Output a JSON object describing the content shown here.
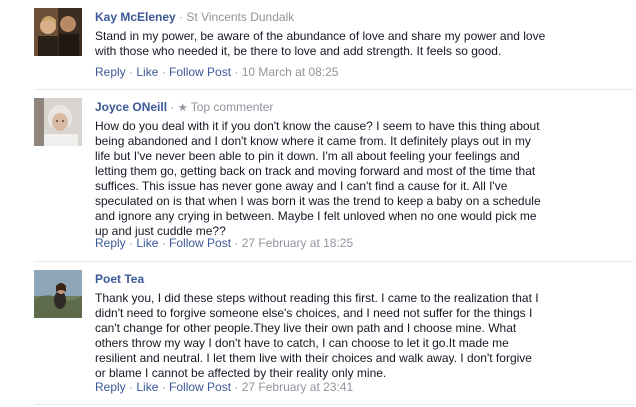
{
  "comments": [
    {
      "name": "Kay McEleney",
      "separator": " · ",
      "affiliation": "St Vincents Dundalk",
      "lines": [
        "Stand in my power, be aware of the abundance of love and share my power and love",
        "with those who needed it, be there to love and add strength. It feels so good."
      ],
      "actions": {
        "reply": "Reply",
        "like": "Like",
        "follow": "Follow Post"
      },
      "dot": " · ",
      "time": "10 March at 08:25"
    },
    {
      "name": "Joyce ONeill",
      "separator": " · ",
      "badge_icon": "★",
      "badge": "Top commenter",
      "lines": [
        "How do you deal with it if you don't know the cause? I seem to have this thing about",
        "being abandoned and I don't know where it came from. It definitely plays out in my",
        "life but I've never been able to pin it down. I'm all about feeling your feelings and",
        "letting them go, getting back on track and moving forward and most of the time that",
        "suffices. This issue has never gone away and I can't find a cause for it. All I've",
        "speculated on is that when I was born it was the trend to keep a baby on a schedule",
        "and ignore any crying in between. Maybe I felt unloved when no one would pick me",
        "up and just cuddle me??"
      ],
      "actions": {
        "reply": "Reply",
        "like": "Like",
        "follow": "Follow Post"
      },
      "dot": " · ",
      "time": "27 February at 18:25"
    },
    {
      "name": "Poet Tea",
      "lines": [
        "Thank you, I did these steps without reading this first. I came to the realization that I",
        "didn't need to forgive someone else's choices, and I need not suffer for the things I",
        "can't change for other people.They live their own path and I choose mine. What",
        "others throw my way I don't have to catch, I can choose to let it go.It made me",
        "resilient and neutral. I let them live with their choices and walk away. I don't forgive",
        "or blame I cannot be affected by their reality only mine."
      ],
      "actions": {
        "reply": "Reply",
        "like": "Like",
        "follow": "Follow Post"
      },
      "dot": " · ",
      "time": "27 February at 23:41"
    }
  ],
  "colors": {
    "link": "#3b5998",
    "meta": "#90949c",
    "text": "#141823",
    "divider": "#e9eaed"
  }
}
